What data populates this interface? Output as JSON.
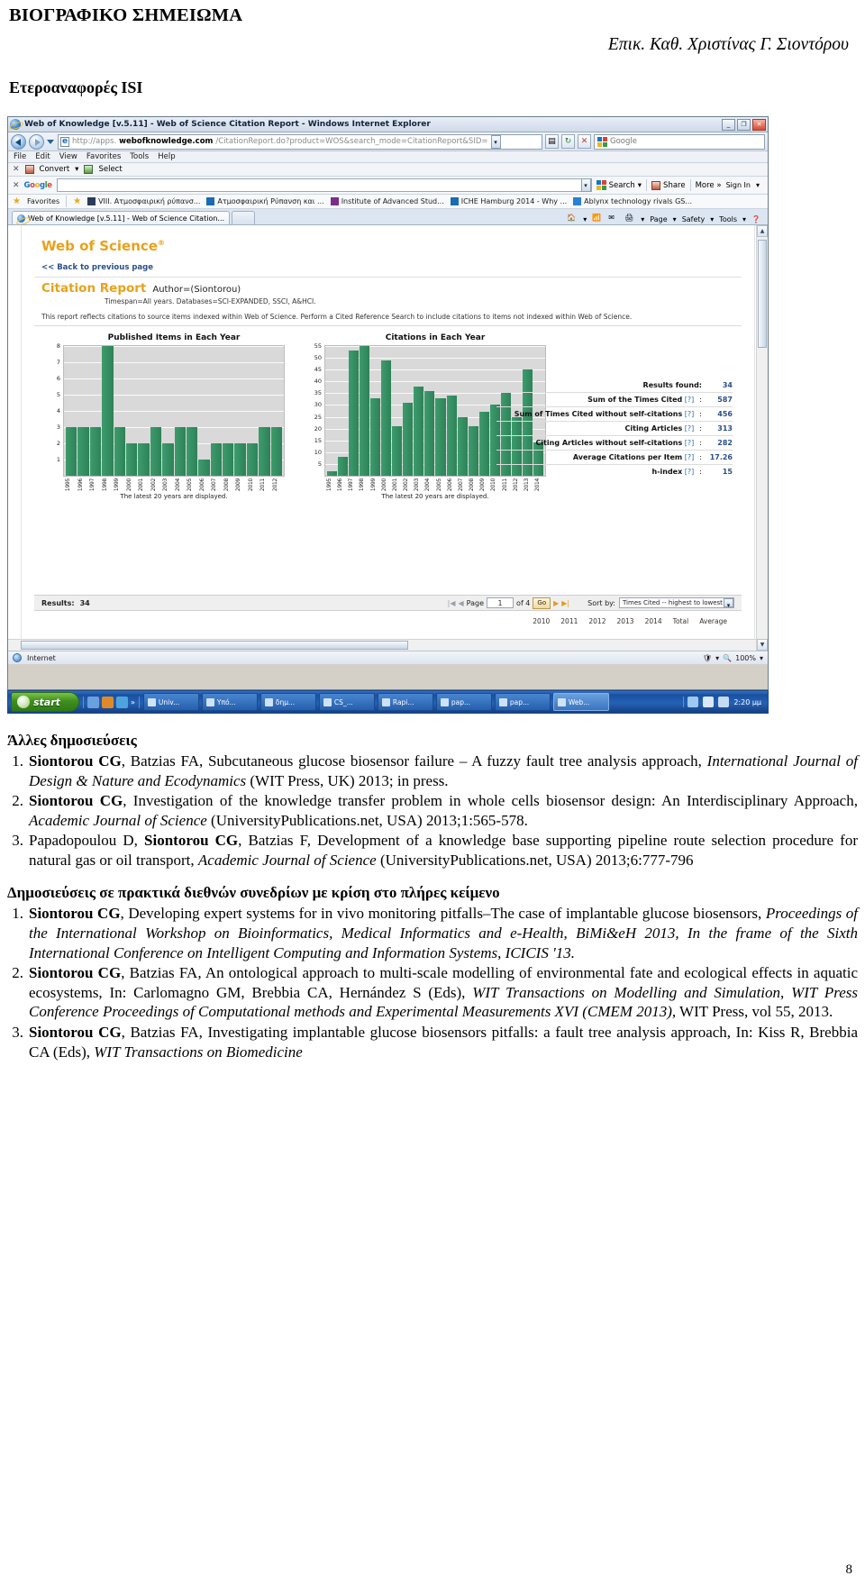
{
  "cv": {
    "title": "ΒΙΟΓΡΑΦΙΚΟ ΣΗΜΕΙΩΜΑ",
    "author": "Επικ. Καθ. Χριστίνας Γ. Σιοντόρου",
    "subsection": "Ετεροαναφορές ISI",
    "page_number": "8"
  },
  "browser": {
    "window_title": "Web of Knowledge [v.5.11] - Web of Science Citation Report - Windows Internet Explorer",
    "window_buttons": {
      "minimize": "_",
      "maximize": "❐",
      "close": "✕"
    },
    "url_prefix": "http://apps.",
    "url_strong": "webofknowledge.com",
    "url_rest": "/CitationReport.do?product=WOS&search_mode=CitationReport&SID=",
    "search_placeholder": "Google",
    "menu": [
      "File",
      "Edit",
      "View",
      "Favorites",
      "Tools",
      "Help"
    ],
    "convert_bar": {
      "close": "✕",
      "convert": "Convert",
      "select": "Select"
    },
    "google_bar": {
      "close": "✕",
      "brand": "Google",
      "value": "",
      "search": "Search",
      "share": "Share",
      "more": "More »",
      "signin": "Sign In"
    },
    "favorites_bar": {
      "favorites_label": "Favorites",
      "items": [
        "VIII. Ατμοσφαιρική ρύπανσ...",
        "Ατμοσφαιρική Ρύπανση και ...",
        "Institute of Advanced Stud...",
        "ICHE Hamburg 2014 - Why ...",
        "Ablynx technology rivals GS..."
      ]
    },
    "tab": {
      "label": "Web of Knowledge [v.5.11] - Web of Science Citation..."
    },
    "toolbar_right": [
      "Page",
      "Safety",
      "Tools"
    ],
    "status": {
      "zone": "Internet",
      "zoom": "100%"
    }
  },
  "page": {
    "logo": "Web of Science",
    "logo_mark": "®",
    "back_link": "<< Back to previous page",
    "report_title": "Citation Report",
    "query": "Author=(Siontorou)",
    "timespan": "Timespan=All years. Databases=SCI-EXPANDED, SSCI, A&HCI.",
    "description": "This report reflects citations to source items indexed within Web of Science. Perform a Cited Reference Search to include citations to items not indexed within Web of Science.",
    "results_panel": [
      {
        "label": "Results found:",
        "help": "",
        "value": "34"
      },
      {
        "label": "Sum of the Times Cited",
        "help": "[?]",
        "value": "587"
      },
      {
        "label": "Sum of Times Cited without self-citations",
        "help": "[?]",
        "value": "456"
      },
      {
        "label": "Citing Articles",
        "help": "[?]",
        "value": "313"
      },
      {
        "label": "Citing Articles without self-citations",
        "help": "[?]",
        "value": "282"
      },
      {
        "label": "Average Citations per Item",
        "help": "[?]",
        "value": "17.26"
      },
      {
        "label": "h-index",
        "help": "[?]",
        "value": "15"
      }
    ],
    "grid_bar": {
      "results_label": "Results:",
      "results_value": "34",
      "page_label": "Page",
      "page_value": "1",
      "page_of": "of 4",
      "go": "Go",
      "sort_label": "Sort by:",
      "sort_value": "Times Cited -- highest to lowest"
    },
    "tail_years": [
      "2010",
      "2011",
      "2012",
      "2013",
      "2014",
      "Total",
      "Average"
    ]
  },
  "chart_data": [
    {
      "type": "bar",
      "title": "Published Items in Each Year",
      "footer": "The latest 20 years are displayed.",
      "xlabel": "",
      "ylabel": "",
      "ylim": [
        0,
        8
      ],
      "yticks": [
        8,
        7,
        6,
        5,
        4,
        3,
        2,
        1
      ],
      "categories": [
        "1995",
        "1996",
        "1997",
        "1998",
        "1999",
        "2000",
        "2001",
        "2002",
        "2003",
        "2004",
        "2005",
        "2006",
        "2007",
        "2008",
        "2009",
        "2010",
        "2011",
        "2012"
      ],
      "values": [
        3,
        3,
        3,
        8,
        3,
        2,
        2,
        3,
        2,
        3,
        3,
        1,
        2,
        2,
        2,
        2,
        3,
        3
      ]
    },
    {
      "type": "bar",
      "title": "Citations in Each Year",
      "footer": "The latest 20 years are displayed.",
      "xlabel": "",
      "ylabel": "",
      "ylim": [
        0,
        55
      ],
      "yticks": [
        55,
        50,
        45,
        40,
        35,
        30,
        25,
        20,
        15,
        10,
        5
      ],
      "categories": [
        "1995",
        "1996",
        "1997",
        "1998",
        "1999",
        "2000",
        "2001",
        "2002",
        "2003",
        "2004",
        "2005",
        "2006",
        "2007",
        "2008",
        "2009",
        "2010",
        "2011",
        "2012",
        "2013",
        "2014"
      ],
      "values": [
        2,
        8,
        53,
        55,
        33,
        49,
        21,
        31,
        38,
        36,
        33,
        34,
        25,
        21,
        27,
        30,
        35,
        25,
        45,
        14
      ]
    }
  ],
  "taskbar": {
    "start": "start",
    "tasks": [
      "Univ...",
      "Υπό...",
      "δημ...",
      "CS_...",
      "Rapi...",
      "pap...",
      "pap...",
      "Web..."
    ],
    "clock": "2:20 μμ"
  },
  "publications": {
    "other_heading": "Άλλες δημοσιεύσεις",
    "other": [
      {
        "num": "1.",
        "segments": [
          {
            "t": "Siontorou CG",
            "s": "b"
          },
          {
            "t": ", Batzias FA, Subcutaneous glucose biosensor failure – A fuzzy fault tree analysis approach, ",
            "s": "n"
          },
          {
            "t": "International Journal of Design & Nature and Ecodynamics",
            "s": "i"
          },
          {
            "t": " (WIT Press, UK) 2013; in press.",
            "s": "n"
          }
        ]
      },
      {
        "num": "2.",
        "segments": [
          {
            "t": "Siontorou CG",
            "s": "b"
          },
          {
            "t": ", Investigation of the knowledge transfer problem in whole cells biosensor design: An Interdisciplinary Approach, ",
            "s": "n"
          },
          {
            "t": "Academic Journal of Science",
            "s": "i"
          },
          {
            "t": " (UniversityPublications.net, USA) 2013;1:565-578.",
            "s": "n"
          }
        ]
      },
      {
        "num": "3.",
        "segments": [
          {
            "t": "Papadopoulou D, ",
            "s": "n"
          },
          {
            "t": "Siontorou CG",
            "s": "b"
          },
          {
            "t": ", Batzias F, Development of a knowledge base supporting pipeline route selection procedure for natural gas or oil transport, ",
            "s": "n"
          },
          {
            "t": "Academic Journal of Science",
            "s": "i"
          },
          {
            "t": " (UniversityPublications.net, USA) 2013;6:777-796",
            "s": "n"
          }
        ]
      }
    ],
    "proceedings_heading": "Δημοσιεύσεις σε πρακτικά διεθνών συνεδρίων με κρίση στο πλήρες κείμενο",
    "proceedings": [
      {
        "num": "1.",
        "segments": [
          {
            "t": "Siontorou CG",
            "s": "b"
          },
          {
            "t": ", Developing expert systems for in vivo monitoring pitfalls–The case of implantable glucose biosensors, ",
            "s": "n"
          },
          {
            "t": "Proceedings of the International Workshop on Bioinformatics, Medical Informatics and e-Health, BiMi&eH 2013, In the frame of the Sixth International Conference on Intelligent Computing and Information Systems, ICICIS '13.",
            "s": "i"
          }
        ]
      },
      {
        "num": "2.",
        "segments": [
          {
            "t": "Siontorou CG",
            "s": "b"
          },
          {
            "t": ", Batzias FA, An ontological approach to multi-scale modelling of environmental fate and ecological effects in aquatic ecosystems, In: Carlomagno GM, Brebbia CA, Hernández S (Eds), ",
            "s": "n"
          },
          {
            "t": "WIT Transactions on Modelling and Simulation, WIT Press Conference Proceedings of Computational methods and Experimental Measurements XVI (CMEM 2013)",
            "s": "i"
          },
          {
            "t": ", WIT Press, vol 55, 2013.",
            "s": "n"
          }
        ]
      },
      {
        "num": "3.",
        "segments": [
          {
            "t": "Siontorou CG",
            "s": "b"
          },
          {
            "t": ", Batzias FA, Investigating implantable glucose biosensors pitfalls: a fault tree analysis approach, In: Kiss R, Brebbia CA (Eds), ",
            "s": "n"
          },
          {
            "t": "WIT Transactions on Biomedicine",
            "s": "i"
          }
        ]
      }
    ]
  }
}
